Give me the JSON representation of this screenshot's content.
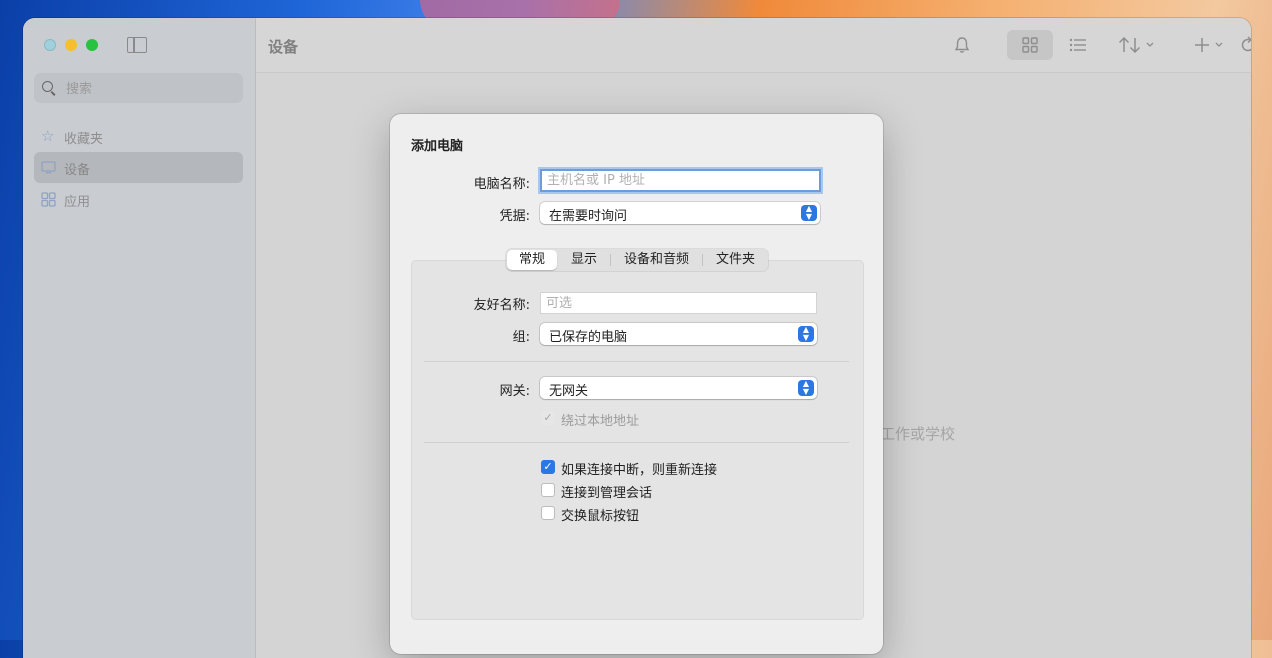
{
  "sidebar": {
    "search_placeholder": "搜索",
    "items": [
      {
        "label": "收藏夹",
        "icon": "star-icon"
      },
      {
        "label": "设备",
        "icon": "display-icon"
      },
      {
        "label": "应用",
        "icon": "apps-grid-icon"
      }
    ]
  },
  "toolbar": {
    "title": "设备",
    "icons": [
      "bell-icon",
      "grid-view-icon",
      "list-view-icon",
      "sort-icon",
      "add-icon",
      "refresh-icon"
    ]
  },
  "main": {
    "empty_text": "工作或学校"
  },
  "dialog": {
    "title": "添加电脑",
    "computer_name_label": "电脑名称:",
    "computer_name_placeholder": "主机名或 IP 地址",
    "credentials_label": "凭据:",
    "credentials_value": "在需要时询问",
    "tabs": [
      "常规",
      "显示",
      "设备和音频",
      "文件夹"
    ],
    "selected_tab": "常规",
    "friendly_name_label": "友好名称:",
    "friendly_name_placeholder": "可选",
    "group_label": "组:",
    "group_value": "已保存的电脑",
    "gateway_label": "网关:",
    "gateway_value": "无网关",
    "bypass_label": "绕过本地地址",
    "reconnect_label": "如果连接中断，则重新连接",
    "admin_session_label": "连接到管理会话",
    "swap_mouse_label": "交换鼠标按钮"
  },
  "colors": {
    "accent": "#2b78e4",
    "focus_ring": "#a9c6ee"
  }
}
